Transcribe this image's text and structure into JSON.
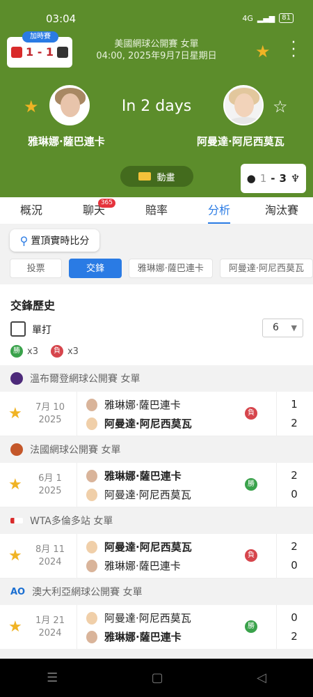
{
  "status": {
    "time": "03:04",
    "signal": "4G",
    "battery": "81"
  },
  "score_card": {
    "tag": "加時賽",
    "score": "1 - 1"
  },
  "match_info": {
    "title": "美國網球公開賽 女單",
    "datetime": "04:00, 2025年9月7日星期日"
  },
  "countdown": "In 2 days",
  "player1": {
    "name": "雅琳娜·薩巴連卡"
  },
  "player2": {
    "name": "阿曼達·阿尼西莫瓦"
  },
  "animation_label": "動畫",
  "h2h_card": {
    "left": "1",
    "dash": "-",
    "right": "3"
  },
  "tabs": [
    {
      "label": "概況"
    },
    {
      "label": "聊天",
      "badge": "365"
    },
    {
      "label": "賠率"
    },
    {
      "label": "分析"
    },
    {
      "label": "淘汰賽"
    }
  ],
  "pin_label": "置頂實時比分",
  "filters": [
    "投票",
    "交鋒",
    "雅琳娜·薩巴連卡",
    "阿曼達·阿尼西莫瓦"
  ],
  "h2h": {
    "title": "交鋒歷史",
    "singles_label": "單打",
    "count": "6",
    "wins_label": "勝",
    "wins_count": "x3",
    "losses_label": "負",
    "losses_count": "x3"
  },
  "matches": [
    {
      "competition": "溫布爾登網球公開賽 女單",
      "date_line1": "7月 10",
      "date_line2": "2025",
      "p1": "雅琳娜·薩巴連卡",
      "p2": "阿曼達·阿尼西莫瓦",
      "result": "負",
      "s1": "1",
      "s2": "2"
    },
    {
      "competition": "法國網球公開賽 女單",
      "date_line1": "6月 1",
      "date_line2": "2025",
      "p1": "雅琳娜·薩巴連卡",
      "p2": "阿曼達·阿尼西莫瓦",
      "result": "勝",
      "s1": "2",
      "s2": "0"
    },
    {
      "competition": "WTA多倫多站 女單",
      "date_line1": "8月 11",
      "date_line2": "2024",
      "p1": "阿曼達·阿尼西莫瓦",
      "p2": "雅琳娜·薩巴連卡",
      "result": "負",
      "s1": "2",
      "s2": "0"
    },
    {
      "competition": "澳大利亞網球公開賽 女單",
      "date_line1": "1月 21",
      "date_line2": "2024",
      "p1": "阿曼達·阿尼西莫瓦",
      "p2": "雅琳娜·薩巴連卡",
      "result": "勝",
      "s1": "0",
      "s2": "2"
    }
  ],
  "colors": {
    "header_green": "#5c8d2b",
    "accent_blue": "#2a7be4",
    "star": "#f0b324",
    "win": "#3aa24b",
    "loss": "#d6454c"
  }
}
